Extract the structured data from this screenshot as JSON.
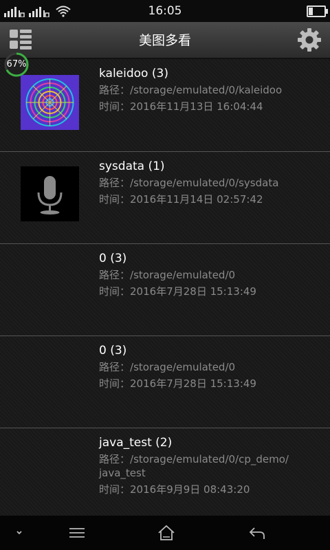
{
  "status": {
    "time": "16:05"
  },
  "header": {
    "title": "美图多看"
  },
  "progress": {
    "label": "67%",
    "value": 0.67
  },
  "labels": {
    "path": "路径：",
    "time": "时间："
  },
  "items": [
    {
      "name": "kaleidoo (3)",
      "path": "/storage/emulated/0/kaleidoo",
      "time": "2016年11月13日 16:04:44",
      "thumb": "kaleidoscope"
    },
    {
      "name": "sysdata (1)",
      "path": "/storage/emulated/0/sysdata",
      "time": "2016年11月14日 02:57:42",
      "thumb": "microphone-icon"
    },
    {
      "name": "0 (3)",
      "path": "/storage/emulated/0",
      "time": "2016年7月28日 15:13:49",
      "thumb": "none"
    },
    {
      "name": "0 (3)",
      "path": "/storage/emulated/0",
      "time": "2016年7月28日 15:13:49",
      "thumb": "none"
    },
    {
      "name": "java_test (2)",
      "path": "/storage/emulated/0/cp_demo/",
      "path2": "java_test",
      "time": "2016年9月9日 08:43:20",
      "thumb": "none"
    }
  ]
}
